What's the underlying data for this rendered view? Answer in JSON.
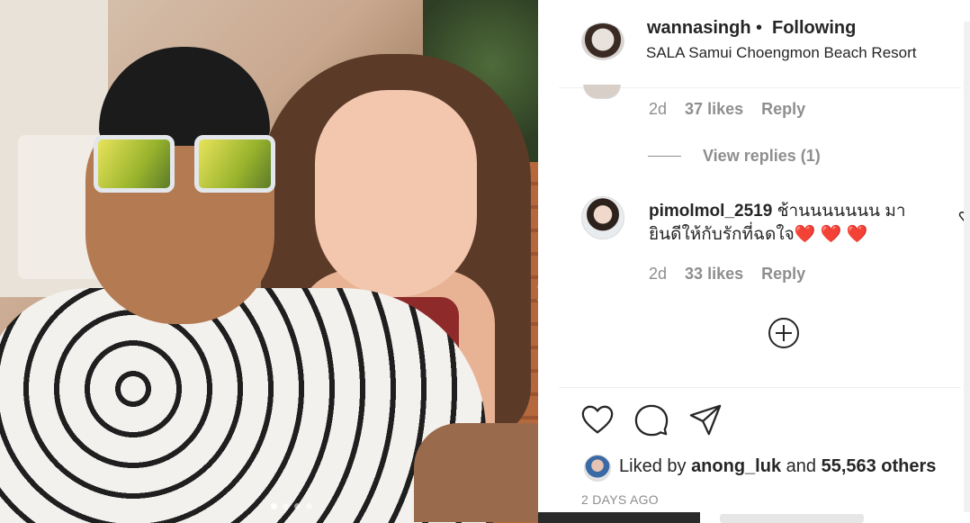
{
  "post": {
    "username": "wannasingh",
    "separator": "•",
    "follow_status": "Following",
    "location": "SALA Samui Choengmon Beach Resort",
    "carousel": {
      "count": 4,
      "active": 1
    }
  },
  "comments": [
    {
      "age": "2d",
      "likes": "37 likes",
      "reply": "Reply",
      "view_replies": "View replies (1)"
    },
    {
      "username": "pimolmol_2519",
      "text": "ช้านนนนนนน มา ยินดีให้กับรักที่ฉดใจ❤️ ❤️ ❤️",
      "age": "2d",
      "likes": "33 likes",
      "reply": "Reply"
    }
  ],
  "liked_by": {
    "prefix": "Liked by",
    "user": "anong_luk",
    "conj": "and",
    "others": "55,563 others"
  },
  "timestamp": "2 DAYS AGO",
  "icons": [
    "heart-icon",
    "comment-icon",
    "share-icon",
    "plus-circle-icon"
  ],
  "colors": {
    "text": "#262626",
    "secondary": "#8e8e8e",
    "border": "#efefef"
  }
}
